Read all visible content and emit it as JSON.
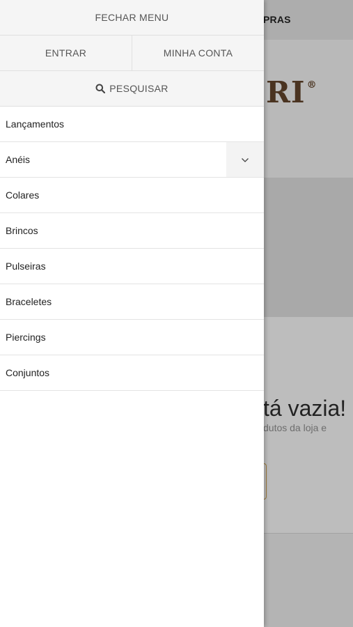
{
  "background": {
    "header_text": "PRAS",
    "logo_text": "RI",
    "logo_mark": "®",
    "empty_title": "tá vazia!",
    "empty_subtitle": "dutos da loja e"
  },
  "drawer": {
    "close_label": "FECHAR MENU",
    "login_label": "ENTRAR",
    "account_label": "MINHA CONTA",
    "search_label": "PESQUISAR",
    "items": [
      {
        "label": "Lançamentos"
      },
      {
        "label": "Anéis",
        "expandable": true,
        "icon": "chevron-down-icon"
      },
      {
        "label": "Colares"
      },
      {
        "label": "Brincos"
      },
      {
        "label": "Pulseiras"
      },
      {
        "label": "Braceletes"
      },
      {
        "label": "Piercings"
      },
      {
        "label": "Conjuntos"
      }
    ]
  },
  "colors": {
    "drawer_bg": "#ffffff",
    "drawer_button_bg": "#f5f5f5",
    "overlay_bg": "#b8b8b8",
    "logo_color": "#4a3320",
    "accent_gold": "#9c7a3c"
  }
}
